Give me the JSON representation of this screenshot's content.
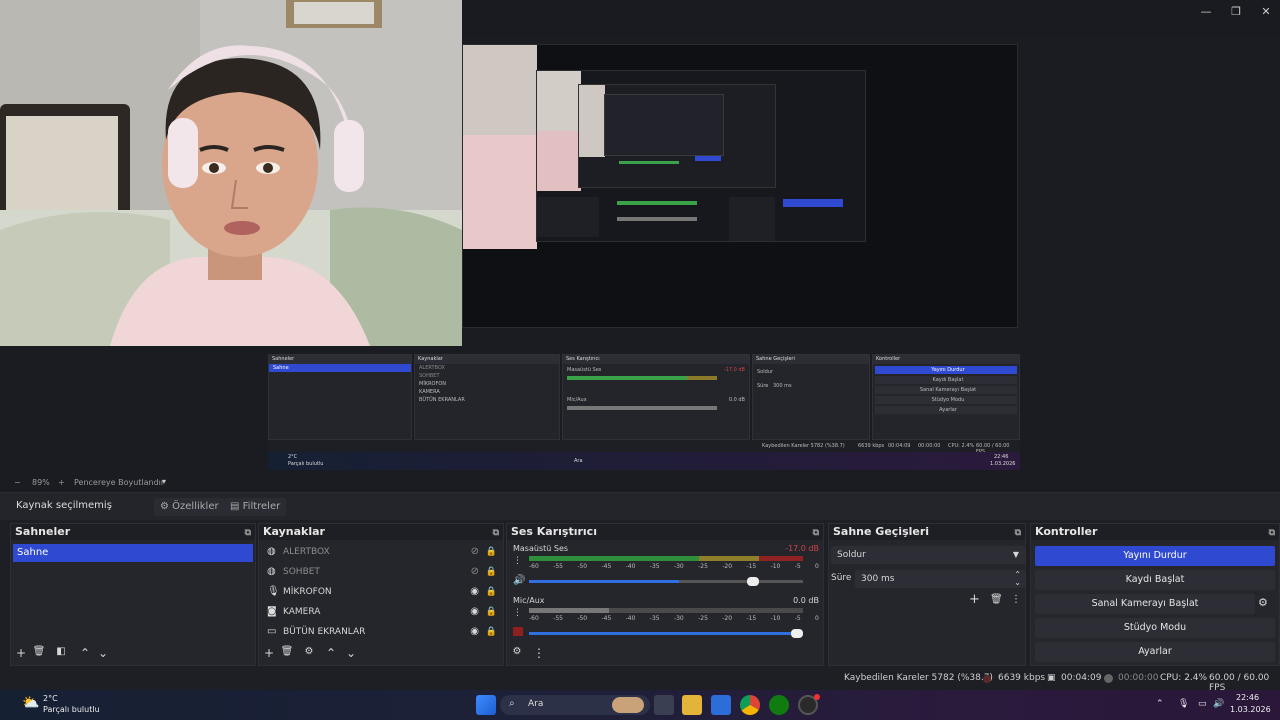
{
  "window": {
    "minimize": "—",
    "restore": "❐",
    "close": "✕"
  },
  "preview": {
    "mini_docks": {
      "scenes_title": "Sahneler",
      "scene": "Sahne",
      "sources_title": "Kaynaklar",
      "sources": [
        "ALERTBOX",
        "SOHBET",
        "MİKROFON",
        "KAMERA",
        "BÜTÜN EKRANLAR"
      ],
      "mixer_title": "Ses Karıştırıcı",
      "mixer_ch1": "Masaüstü Ses",
      "mixer_ch1_db": "-17.0 dB",
      "mixer_ch2": "Mic/Aux",
      "mixer_ch2_db": "0.0 dB",
      "transitions_title": "Sahne Geçişleri",
      "transition": "Soldur",
      "duration_label": "Süre",
      "duration": "300 ms",
      "controls_title": "Kontroller",
      "controls": [
        "Yayını Durdur",
        "Kaydı Başlat",
        "Sanal Kamerayı Başlat",
        "Stüdyo Modu",
        "Ayarlar"
      ],
      "stats": "Kaybedilen Kareler 5782 (%38.7)",
      "kbps": "6639 kbps",
      "time1": "00:04:09",
      "time2": "00:00:00",
      "cpu": "CPU: 2.4%",
      "fps": "60.00 / 60.00 FPS",
      "weather_temp": "2°C",
      "weather_text": "Parçalı bulutlu",
      "search": "Ara",
      "clock_time": "22:46",
      "clock_date": "1.03.2026"
    }
  },
  "zoom": {
    "minus": "−",
    "value": "89%",
    "plus": "+",
    "mode": "Pencereye Boyutlandır",
    "caret": "▾"
  },
  "source_toolbar": {
    "no_source": "Kaynak seçilmemiş",
    "properties": "Özellikler",
    "filters": "Filtreler"
  },
  "scenes": {
    "title": "Sahneler",
    "items": [
      "Sahne"
    ]
  },
  "sources": {
    "title": "Kaynaklar",
    "items": [
      {
        "name": "ALERTBOX",
        "icon": "browser-icon",
        "visible": false
      },
      {
        "name": "SOHBET",
        "icon": "browser-icon",
        "visible": false
      },
      {
        "name": "MİKROFON",
        "icon": "mic-icon",
        "visible": true
      },
      {
        "name": "KAMERA",
        "icon": "camera-icon",
        "visible": true
      },
      {
        "name": "BÜTÜN EKRANLAR",
        "icon": "monitor-icon",
        "visible": true
      }
    ]
  },
  "mixer": {
    "title": "Ses Karıştırıcı",
    "channels": [
      {
        "name": "Masaüstü Ses",
        "db": "-17.0 dB",
        "volume": 0.84
      },
      {
        "name": "Mic/Aux",
        "db": "0.0 dB",
        "volume": 1.0
      }
    ],
    "ticks": [
      "-60",
      "-55",
      "-50",
      "-45",
      "-40",
      "-35",
      "-30",
      "-25",
      "-20",
      "-15",
      "-10",
      "-5",
      "0"
    ]
  },
  "transitions": {
    "title": "Sahne Geçişleri",
    "selected": "Soldur",
    "duration_label": "Süre",
    "duration": "300 ms"
  },
  "controls": {
    "title": "Kontroller",
    "stop_stream": "Yayını Durdur",
    "start_recording": "Kaydı Başlat",
    "start_virtualcam": "Sanal Kamerayı Başlat",
    "studio_mode": "Stüdyo Modu",
    "settings": "Ayarlar"
  },
  "status": {
    "dropped": "Kaybedilen Kareler 5782 (%38.7)",
    "kbps": "6639 kbps",
    "stream_time": "00:04:09",
    "rec_time": "00:00:00",
    "cpu": "CPU: 2.4%",
    "fps": "60.00 / 60.00 FPS"
  },
  "taskbar": {
    "weather_temp": "2°C",
    "weather_text": "Parçalı bulutlu",
    "search": "Ara",
    "time": "22:46",
    "date": "1.03.2026"
  },
  "colors": {
    "accent": "#2f49d1",
    "record": "#c0392b"
  }
}
